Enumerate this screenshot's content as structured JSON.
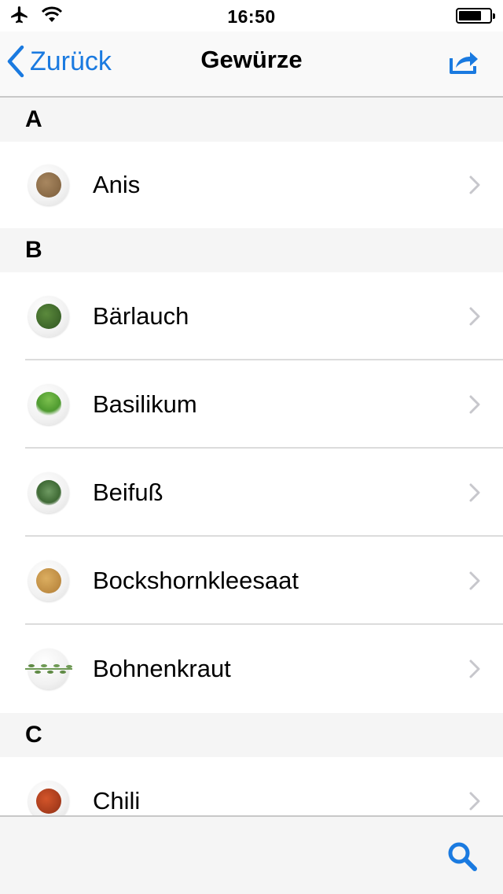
{
  "status_bar": {
    "time": "16:50"
  },
  "nav": {
    "back_label": "Zurück",
    "title": "Gewürze"
  },
  "colors": {
    "accent": "#1a7ae0"
  },
  "sections": [
    {
      "letter": "A",
      "items": [
        {
          "name": "Anis",
          "swatch": "#8a6a45"
        }
      ]
    },
    {
      "letter": "B",
      "items": [
        {
          "name": "Bärlauch",
          "swatch": "#3d6b2a"
        },
        {
          "name": "Basilikum",
          "swatch": "#5aa33a"
        },
        {
          "name": "Beifuß",
          "swatch": "#4f7a45"
        },
        {
          "name": "Bockshornkleesaat",
          "swatch": "#c99a4e"
        },
        {
          "name": "Bohnenkraut",
          "swatch": "#6f9a55"
        }
      ]
    },
    {
      "letter": "C",
      "items": [
        {
          "name": "Chili",
          "swatch": "#b8421f"
        }
      ]
    }
  ],
  "toolbar": {
    "search_icon": "search-icon"
  }
}
